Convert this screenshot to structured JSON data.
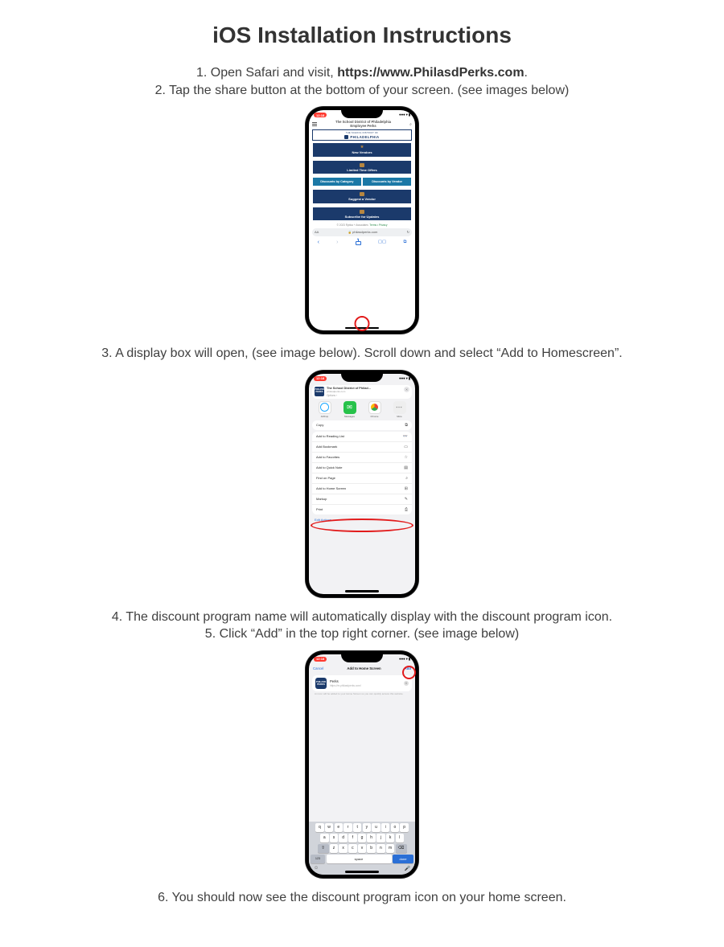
{
  "title": "iOS Installation Instructions",
  "steps": {
    "s1a_prefix": "1. Open Safari and visit, ",
    "s1a_url": "https://www.PhilasdPerks.com",
    "s1a_suffix": ".",
    "s2": "2. Tap the share button at the bottom of your screen. (see images below)",
    "s3": "3. A display box will open, (see image below). Scroll down and select “Add to Homescreen”.",
    "s4": "4. The discount program name will automatically display with the discount program icon.",
    "s5": "5. Click “Add” in the top right corner. (see image below)",
    "s6": "6. You should now see the discount program icon on your home screen."
  },
  "phone_common": {
    "time": "12:18",
    "status_right": "▮▮▮    ▮"
  },
  "shot1": {
    "site_title_l1": "The School District of Philadelphia",
    "site_title_l2": "Employee Perks",
    "logo_top": "THE SCHOOL DISTRICT OF",
    "logo_main": "PHILADELPHIA",
    "cards": {
      "new_vendors": "New Vendors",
      "limited": "Limited Time Offers",
      "by_category": "Discounts by Category",
      "by_vendor": "Discounts by Vendor",
      "suggest": "Suggest a Vendor",
      "subscribe": "Subscribe for Updates"
    },
    "footer_left": "© 2023 Rybka + Associates",
    "footer_right": "Terms  •  Privacy",
    "url_aa": "AA",
    "url_text": "philasdperks.com",
    "url_reload": "↻"
  },
  "shot2": {
    "head_title": "The School District of Philad…",
    "head_sub": "philasdperks.com",
    "head_options": "Options",
    "apps": {
      "airdrop": "AirDrop",
      "messages": "Messages",
      "chrome": "Chrome",
      "more": "More"
    },
    "items": {
      "copy": "Copy",
      "reading": "Add to Reading List",
      "bookmark": "Add Bookmark",
      "favorites": "Add to Favorites",
      "quicknote": "Add to Quick Note",
      "findpage": "Find on Page",
      "homescreen": "Add to Home Screen",
      "markup": "Markup",
      "print": "Print"
    },
    "edit": "Edit Actions…",
    "thumb": "PHILASD PERKS"
  },
  "shot3": {
    "cancel": "Cancel",
    "title": "Add to Home Screen",
    "add": "Add",
    "name": "Perks",
    "url": "https://m.philasdperks.com/",
    "note": "An icon will be added to your Home Screen so you can quickly access this website.",
    "thumb": "PHILASD PERKS",
    "kb_rows": {
      "r1": [
        "q",
        "w",
        "e",
        "r",
        "t",
        "y",
        "u",
        "i",
        "o",
        "p"
      ],
      "r2": [
        "a",
        "s",
        "d",
        "f",
        "g",
        "h",
        "j",
        "k",
        "l"
      ],
      "r3_shift": "⇧",
      "r3": [
        "z",
        "x",
        "c",
        "v",
        "b",
        "n",
        "m"
      ],
      "r3_bksp": "⌫",
      "k123": "123",
      "space": "space",
      "done": "done",
      "emoji": "☺",
      "mic": "🎤"
    }
  }
}
